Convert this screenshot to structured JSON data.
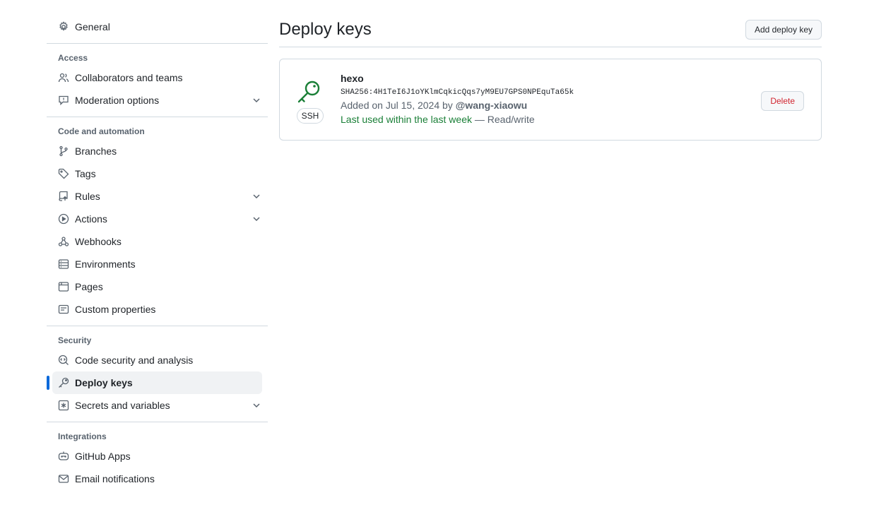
{
  "sidebar": {
    "general": "General",
    "sections": {
      "access": {
        "heading": "Access",
        "collaborators": "Collaborators and teams",
        "moderation": "Moderation options"
      },
      "code": {
        "heading": "Code and automation",
        "branches": "Branches",
        "tags": "Tags",
        "rules": "Rules",
        "actions": "Actions",
        "webhooks": "Webhooks",
        "environments": "Environments",
        "pages": "Pages",
        "custom_properties": "Custom properties"
      },
      "security": {
        "heading": "Security",
        "code_security": "Code security and analysis",
        "deploy_keys": "Deploy keys",
        "secrets": "Secrets and variables"
      },
      "integrations": {
        "heading": "Integrations",
        "github_apps": "GitHub Apps",
        "email_notifications": "Email notifications"
      }
    },
    "active_item": "Deploy keys"
  },
  "main": {
    "title": "Deploy keys",
    "add_button": "Add deploy key",
    "keys": [
      {
        "title": "hexo",
        "type_badge": "SSH",
        "fingerprint": "SHA256:4H1TeI6J1oYKlmCqkicQqs7yM9EU7GPS0NPEquTa65k",
        "added_prefix": "Added on Jul 15, 2024 by",
        "added_by": "@wang-xiaowu",
        "last_used": "Last used within the last week",
        "separator": "—",
        "access": "Read/write",
        "delete_label": "Delete"
      }
    ]
  },
  "colors": {
    "accent": "#0969da",
    "success": "#1a7f37",
    "danger": "#d1242f",
    "border": "#d1d9e0",
    "muted": "#59636e"
  }
}
